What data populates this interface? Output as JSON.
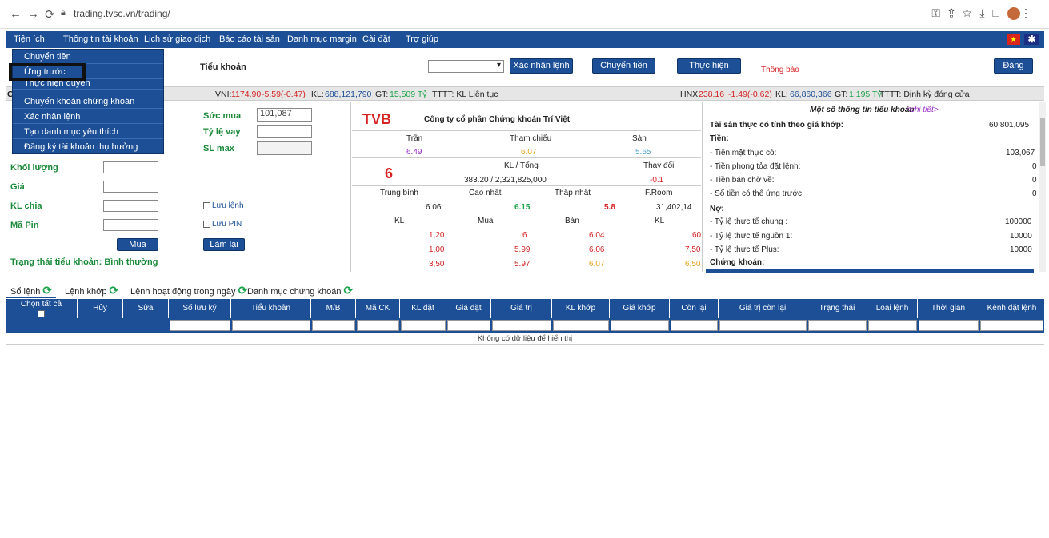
{
  "browser": {
    "url": "trading.tvsc.vn/trading/"
  },
  "menubar": {
    "items": [
      "Tiện ích",
      "Thông tin tài khoản",
      "Lịch sử giao dịch",
      "Báo cáo tài sản",
      "Danh mục margin",
      "Cài đặt",
      "Trợ giúp"
    ]
  },
  "dropdown": {
    "items": [
      "Chuyển tiền",
      "Ứng trước",
      "Thực hiện quyền",
      "Chuyển khoản chứng khoán",
      "Xác nhận lệnh",
      "Tạo danh mục yêu thích",
      "Đăng ký tài khoản thụ hưởng"
    ]
  },
  "toolbar": {
    "tieu_khoan": "Tiểu khoản",
    "xac_nhan_lenh": "Xác nhận lệnh",
    "chuyen_tien": "Chuyển tiền",
    "thuc_hien_quyen": "Thực hiện quyền",
    "thong_bao": "Thông báo",
    "dang_xuat": "Đăng xuất"
  },
  "indexbar": {
    "vni_label": "VNI:",
    "vni_value": "1174.90",
    "vni_change": "-5.59(-0.47)",
    "vni_rest_1": "KL:",
    "vni_kl": "688,121,790",
    "vni_rest_2": "GT:",
    "vni_gt": "15,509 Tỷ",
    "vni_rest_3": "TTTT: KL Liên tục",
    "hnx_label": "HNX:",
    "hnx_value": "238.16",
    "hnx_change": "-1.49(-0.62)",
    "hnx_rest_1": "KL:",
    "hnx_kl": "66,860,366",
    "hnx_rest_2": "GT:",
    "hnx_gt": "1,195 Tỷ",
    "hnx_rest_3": "TTTT: Định kỳ đóng cửa"
  },
  "order_form": {
    "khoi_luong": "Khối lượng",
    "gia": "Giá",
    "kl_chia": "KL chia",
    "ma_pin": "Mã Pin",
    "mua_btn": "Mua",
    "lam_lai_btn": "Làm lại",
    "luu_lenh": "Lưu lệnh",
    "luu_pin": "Lưu PIN",
    "suc_mua": "Sức mua",
    "suc_mua_value": "101,087",
    "ty_le_vay": "Tỷ lệ vay",
    "sl_max": "SL max",
    "trang_thai": "Trạng thái tiểu khoản: Bình thường"
  },
  "stock": {
    "code": "TVB",
    "company": "Công ty cổ phần Chứng khoán Trí Việt",
    "tran_label": "Trần",
    "tham_chieu_label": "Tham chiếu",
    "san_label": "Sàn",
    "tran": "6.49",
    "tham_chieu": "6.07",
    "san": "5.65",
    "price": "6",
    "kl_tong_label": "KL / Tổng",
    "kl_tong": "383.20 / 2,321,825,000",
    "thay_doi_label": "Thay đổi",
    "thay_doi": "-0.1",
    "trung_binh_label": "Trung bình",
    "cao_nhat_label": "Cao nhất",
    "thap_nhat_label": "Thấp nhất",
    "froom_label": "F.Room",
    "trung_binh": "6.06",
    "cao_nhat": "6.15",
    "thap_nhat": "5.8",
    "froom": "31,402,14",
    "ob_headers": [
      "KL",
      "Mua",
      "Bán",
      "KL"
    ],
    "orderbook": [
      [
        "1,20",
        "6",
        "6.04",
        "60"
      ],
      [
        "1,00",
        "5.99",
        "6.06",
        "7,50"
      ],
      [
        "3,50",
        "5.97",
        "6.07",
        "6,50"
      ]
    ]
  },
  "account": {
    "title": "Một số thông tin tiểu khoản",
    "detail_link": "<chi tiết>",
    "tai_san_label": "Tài sản thực có tính theo giá khớp:",
    "tai_san": "60,801,095",
    "tien_label": "Tiền:",
    "rows": [
      [
        "- Tiền mặt thực có:",
        "103,067"
      ],
      [
        "- Tiền phong tỏa đặt lệnh:",
        "0"
      ],
      [
        "- Tiền bán chờ về:",
        "0"
      ],
      [
        "- Số tiền có thể ứng trước:",
        "0"
      ]
    ],
    "no_label": "Nợ:",
    "no_rows": [
      [
        "- Tỷ lệ thực tế chung :",
        "100000"
      ],
      [
        "- Tỷ lệ thực tế nguồn 1:",
        "10000"
      ],
      [
        "- Tỷ lệ thực tế Plus:",
        "10000"
      ]
    ],
    "chung_khoan_label": "Chứng khoán:"
  },
  "tabs": [
    "Sổ lệnh",
    "Lệnh khớp",
    "Lệnh hoạt động trong ngày",
    "Danh mục chứng khoán"
  ],
  "table": {
    "headers": [
      "Chọn tất cả",
      "Hủy",
      "Sửa",
      "Số lưu ký",
      "Tiểu khoản",
      "M/B",
      "Mã CK",
      "KL đặt",
      "Giá đặt",
      "Giá trị",
      "KL khớp",
      "Giá khớp",
      "Còn lại",
      "Giá trị còn lại",
      "Trạng thái",
      "Loại lệnh",
      "Thời gian",
      "Kênh đặt lệnh"
    ],
    "empty_text": "Không có dữ liệu để hiển thị"
  }
}
